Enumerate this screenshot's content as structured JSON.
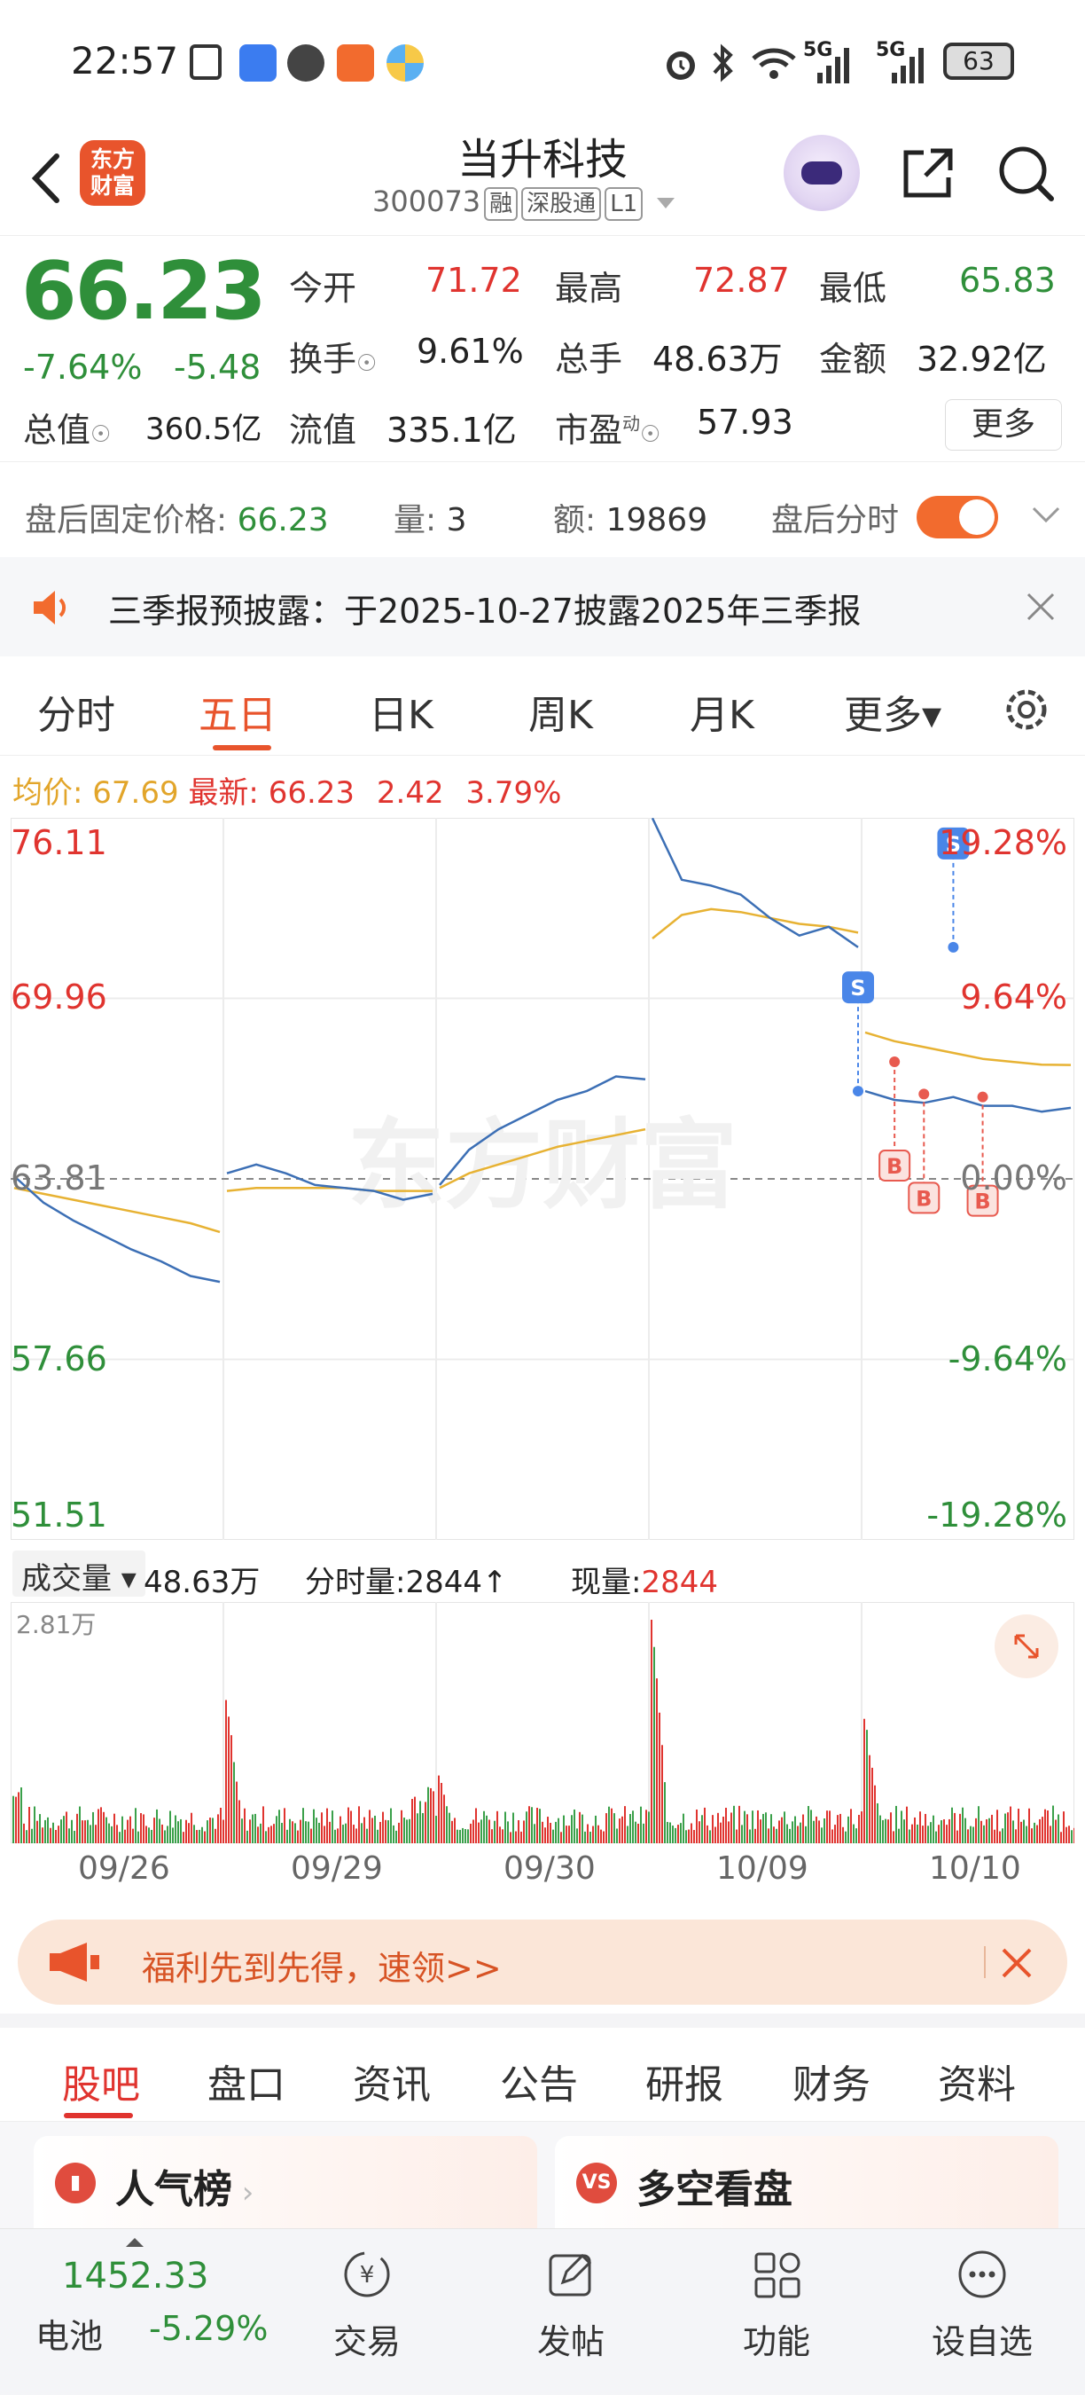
{
  "status_bar": {
    "time": "22:57",
    "battery": "63",
    "network": [
      "5G",
      "5G"
    ]
  },
  "header": {
    "app_logo_text": "东方\n财富",
    "title": "当升科技",
    "code": "300073",
    "tags": [
      "融",
      "深股通",
      "L1"
    ]
  },
  "quote": {
    "price": "66.23",
    "change_pct": "-7.64%",
    "change_abs": "-5.48",
    "rows": [
      [
        {
          "label": "今开",
          "value": "71.72",
          "color": "red"
        },
        {
          "label": "最高",
          "value": "72.87",
          "color": "red"
        },
        {
          "label": "最低",
          "value": "65.83",
          "color": "green"
        }
      ],
      [
        {
          "label": "换手",
          "value": "9.61%",
          "color": "dark"
        },
        {
          "label": "总手",
          "value": "48.63万",
          "color": "dark"
        },
        {
          "label": "金额",
          "value": "32.92亿",
          "color": "dark"
        }
      ],
      [
        {
          "label": "总值",
          "value": "360.5亿",
          "color": "dark"
        },
        {
          "label": "流值",
          "value": "335.1亿",
          "color": "dark"
        },
        {
          "label": "市盈",
          "value": "57.93",
          "color": "dark"
        }
      ]
    ],
    "pe_superscript": "动",
    "more_label": "更多"
  },
  "after_hours": {
    "fixed_price_label": "盘后固定价格:",
    "fixed_price": "66.23",
    "volume_label": "量:",
    "volume": "3",
    "amount_label": "额:",
    "amount": "19869",
    "toggle_label": "盘后分时",
    "toggle_on": true
  },
  "notice": {
    "text": "三季报预披露：于2025-10-27披露2025年三季报"
  },
  "chart_tabs": {
    "items": [
      "分时",
      "五日",
      "日K",
      "周K",
      "月K",
      "更多▾"
    ],
    "active": "五日"
  },
  "chart_info": {
    "avg_label": "均价:",
    "avg": "67.69",
    "latest_label": "最新:",
    "latest": "66.23",
    "latest_chg": "2.42",
    "latest_pct": "3.79%"
  },
  "chart_data": {
    "type": "line",
    "title": "",
    "x": [
      "09/26",
      "09/29",
      "09/30",
      "10/09",
      "10/10"
    ],
    "y_left_ticks": [
      "76.11",
      "69.96",
      "63.81",
      "57.66",
      "51.51"
    ],
    "y_right_ticks": [
      "19.28%",
      "9.64%",
      "0.00%",
      "-9.64%",
      "-19.28%"
    ],
    "ylim": [
      51.51,
      76.11
    ],
    "baseline": 63.81,
    "watermark": "东方财富",
    "series": [
      {
        "name": "price",
        "color": "#3c6fb5",
        "values": [
          63.9,
          63.0,
          62.4,
          61.9,
          61.4,
          61.0,
          60.5,
          60.3,
          64.0,
          64.3,
          64.0,
          63.6,
          63.5,
          63.4,
          63.1,
          63.3,
          63.6,
          64.8,
          65.5,
          66.0,
          66.5,
          66.8,
          67.3,
          67.2,
          76.1,
          74.0,
          73.8,
          73.5,
          72.7,
          72.1,
          72.4,
          71.7,
          66.8,
          66.5,
          66.4,
          66.6,
          66.3,
          66.3,
          66.1,
          66.23
        ]
      },
      {
        "name": "average",
        "color": "#e7b233",
        "values": [
          63.5,
          63.3,
          63.1,
          62.9,
          62.7,
          62.5,
          62.3,
          62.0,
          63.4,
          63.5,
          63.5,
          63.5,
          63.5,
          63.4,
          63.4,
          63.4,
          63.5,
          64.0,
          64.3,
          64.6,
          64.9,
          65.1,
          65.3,
          65.5,
          72.0,
          72.8,
          73.0,
          72.9,
          72.7,
          72.5,
          72.4,
          72.2,
          68.8,
          68.5,
          68.3,
          68.1,
          67.9,
          67.8,
          67.7,
          67.69
        ]
      }
    ],
    "markers": [
      {
        "type": "S",
        "day": 3,
        "pos": 7,
        "price": 66.8
      },
      {
        "type": "S",
        "day": 4,
        "pos": 3,
        "price": 71.7
      },
      {
        "type": "B",
        "day": 4,
        "pos": 1,
        "price": 67.8
      },
      {
        "type": "B",
        "day": 4,
        "pos": 2,
        "price": 66.7
      },
      {
        "type": "B",
        "day": 4,
        "pos": 4,
        "price": 66.6
      }
    ],
    "volume": {
      "max_label": "2.81万",
      "peaks": [
        0.2,
        0.62,
        0.3,
        1.0,
        0.55
      ]
    }
  },
  "volume_header": {
    "select_label": "成交量 ▾",
    "total": "48.63万",
    "period_label": "分时量:",
    "period_val": "2844↑",
    "now_label": "现量:",
    "now_val": "2844"
  },
  "promo": {
    "text": "福利先到先得，速领>>"
  },
  "sub_tabs": {
    "items": [
      "股吧",
      "盘口",
      "资讯",
      "公告",
      "研报",
      "财务",
      "资料"
    ],
    "active": "股吧"
  },
  "cards": [
    {
      "title": "人气榜",
      "icon": "bar-chart-icon"
    },
    {
      "title": "多空看盘",
      "icon": "vs-icon"
    }
  ],
  "bottom_nav": {
    "index_value": "1452.33",
    "index_name": "电池",
    "index_change": "-5.29%",
    "items": [
      {
        "label": "交易",
        "icon": "trade-icon"
      },
      {
        "label": "发帖",
        "icon": "post-icon"
      },
      {
        "label": "功能",
        "icon": "grid-icon"
      },
      {
        "label": "设自选",
        "icon": "more-icon"
      }
    ]
  }
}
